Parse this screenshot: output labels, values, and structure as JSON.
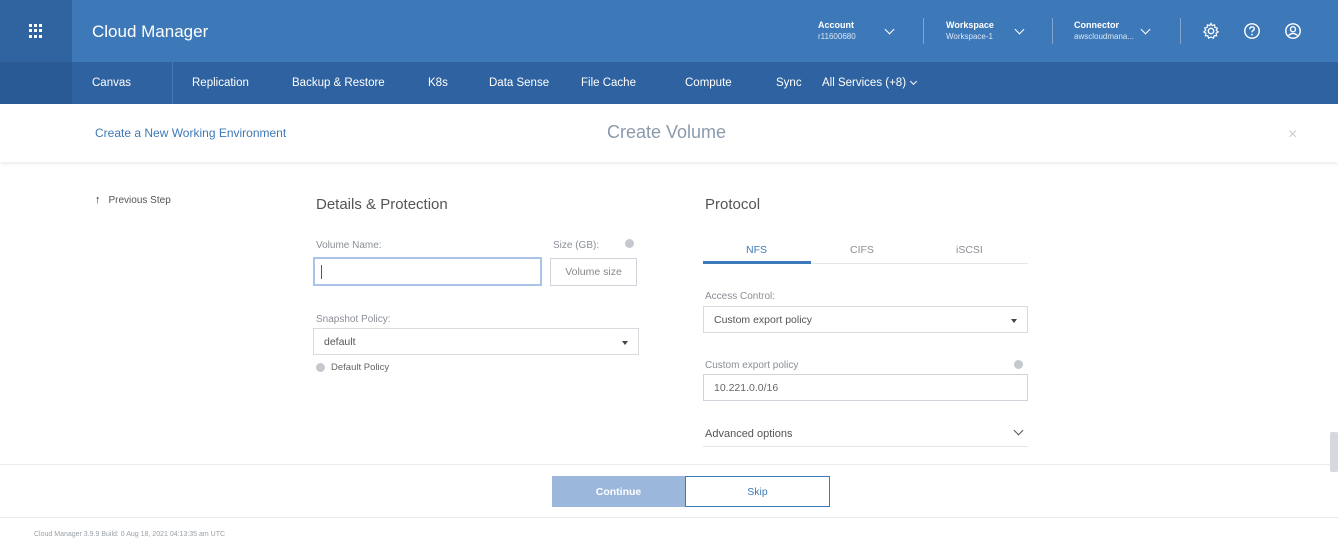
{
  "header": {
    "app_title": "Cloud Manager",
    "account_label": "Account",
    "account_value": "r11600680",
    "workspace_label": "Workspace",
    "workspace_value": "Workspace-1",
    "connector_label": "Connector",
    "connector_value": "awscloudmana..."
  },
  "nav": {
    "items": [
      {
        "label": "Canvas"
      },
      {
        "label": "Replication"
      },
      {
        "label": "Backup & Restore"
      },
      {
        "label": "K8s"
      },
      {
        "label": "Data Sense"
      },
      {
        "label": "File Cache"
      },
      {
        "label": "Compute"
      },
      {
        "label": "Sync"
      },
      {
        "label": "All Services (+8)"
      }
    ]
  },
  "subheader": {
    "breadcrumb": "Create a New Working Environment",
    "title": "Create Volume",
    "close_glyph": "×"
  },
  "previous_step": "Previous Step",
  "details": {
    "section_title": "Details & Protection",
    "volume_name_label": "Volume Name:",
    "volume_name_value": "",
    "size_label": "Size (GB):",
    "size_placeholder": "Volume size",
    "snapshot_label": "Snapshot Policy:",
    "snapshot_value": "default",
    "default_policy_label": "Default Policy"
  },
  "protocol": {
    "section_title": "Protocol",
    "tabs": [
      "NFS",
      "CIFS",
      "iSCSI"
    ],
    "active_tab": "NFS",
    "access_control_label": "Access Control:",
    "access_control_value": "Custom export policy",
    "custom_export_label": "Custom export policy",
    "custom_export_value": "10.221.0.0/16",
    "advanced_options": "Advanced options"
  },
  "actions": {
    "continue": "Continue",
    "skip": "Skip"
  },
  "status_line": "Cloud Manager 3.9.9   Build: 0   Aug 18, 2021 04:13:35 am UTC",
  "colors": {
    "topbar": "#3d79b8",
    "navbar": "#2f62a0",
    "accent": "#3d79b8",
    "continue_disabled": "#9bb7db"
  }
}
